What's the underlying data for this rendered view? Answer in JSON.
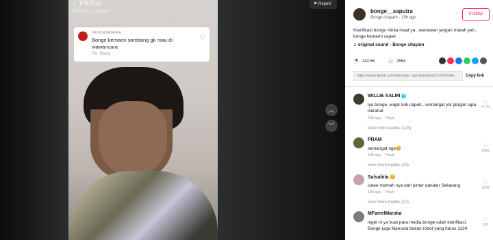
{
  "app": {
    "logo_text": "TikTok"
  },
  "overlay": {
    "watermark_user": "@bonge_saputra",
    "comment_card": {
      "username": "monica.tabanea",
      "text": "Bonge kemarin sombong gk mau di wawancara",
      "time": "7m",
      "reply": "Reply"
    },
    "report_label": "Report"
  },
  "post": {
    "username": "bonge__saputra",
    "display": "Bonge citayam",
    "age": "19h ago",
    "follow_label": "Follow",
    "description": "Klarifikasi bonge minta maaf ya.. wartawan jangan marah yah.. bonge kemarin capek",
    "sound": "original sound - Bonge citayam",
    "likes": "242.5K",
    "comments": "2554",
    "link": "https://www.tiktok.com/@bonge_saputra/video/712835686...",
    "copy_label": "Copy link"
  },
  "comments": [
    {
      "name": "WILLIE SALIM",
      "verified": true,
      "text": "iya bonge, wajar kok capek.. semangat ya! jangan lupa istirahat",
      "age": "18h ago",
      "reply": "Reply",
      "more": "View more replies (124)",
      "likes": "17.7K",
      "avatar_color": "#3d3a2e"
    },
    {
      "name": "PRAM",
      "verified": false,
      "text": "semangat nge🥴",
      "age": "18h ago",
      "reply": "Reply",
      "more": "View more replies (29)",
      "likes": "3420",
      "avatar_color": "#5a6a3a"
    },
    {
      "name": "Salsabila 😊",
      "verified": false,
      "text": "cieee mamah nya dah pinter dandan Sekarang",
      "age": "18h ago",
      "reply": "Reply",
      "more": "View more replies (17)",
      "likes": "2978",
      "avatar_color": "#c9a0a8"
    },
    {
      "name": "MFarrelMarska",
      "verified": false,
      "text": "inget ni ya buat para media,bonge udah klarifikasi. Bonge juga Manusia bukan robot yang harus 1x24",
      "age": "",
      "reply": "",
      "more": "",
      "likes": "356",
      "avatar_color": "#7a7a7a"
    }
  ],
  "share_colors": [
    "#333333",
    "#fe2c55",
    "#1877f2",
    "#25d366",
    "#1da1f2",
    "#555555"
  ]
}
